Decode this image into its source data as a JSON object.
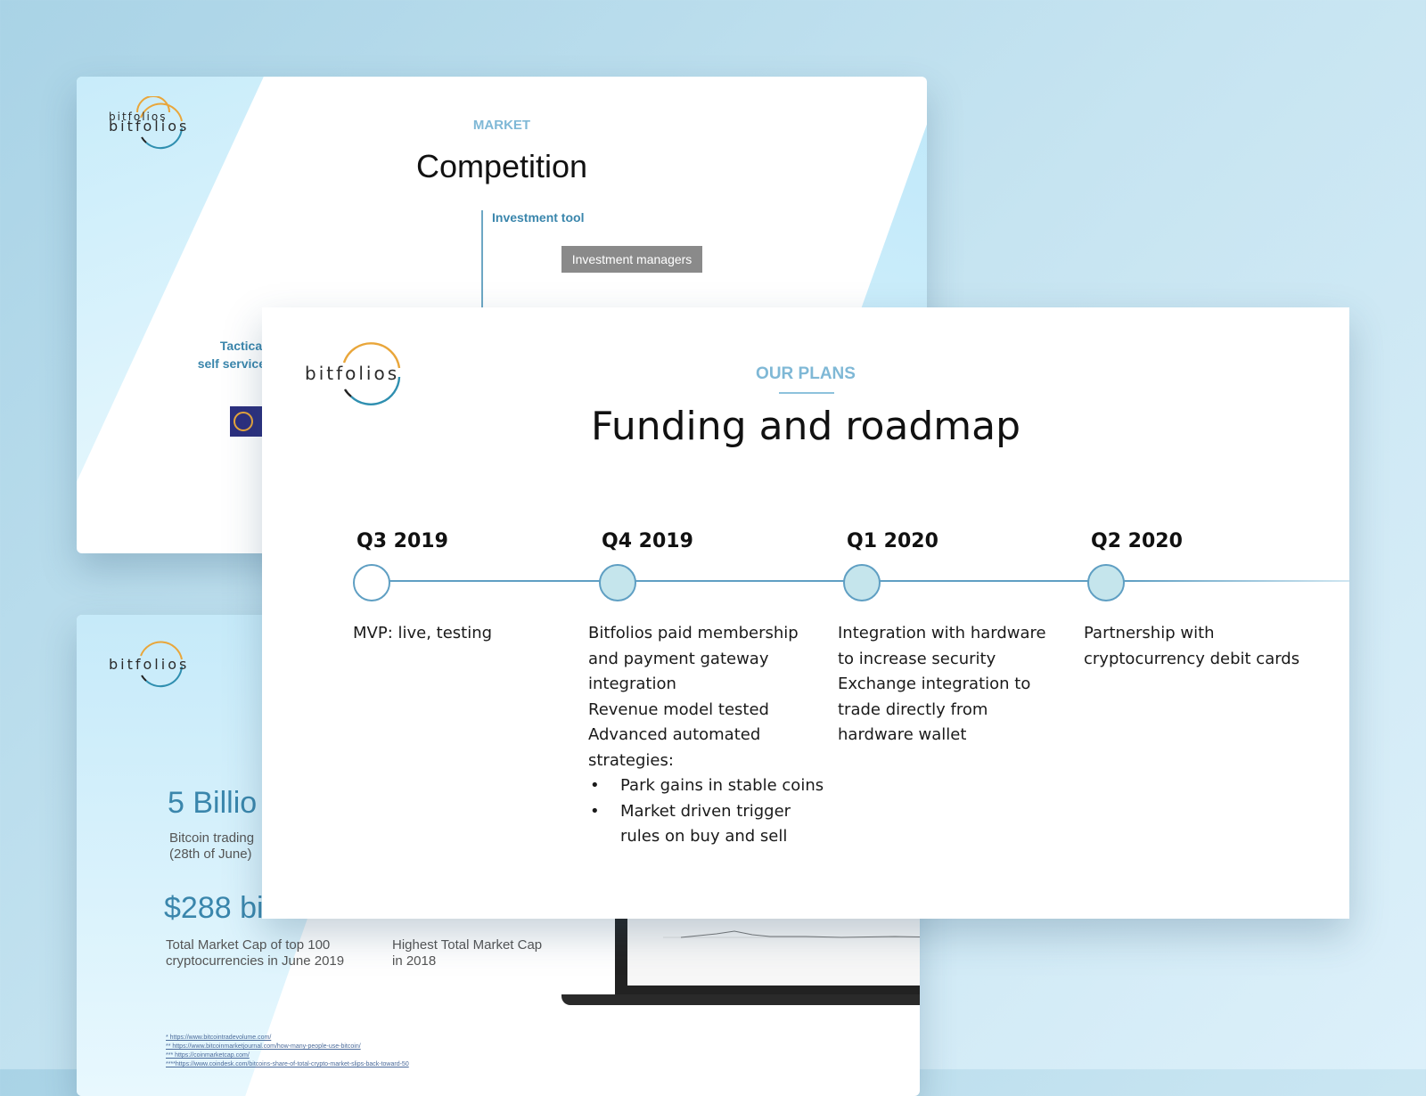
{
  "brand": {
    "logo_text": "bitfolios"
  },
  "competition_slide": {
    "kicker": "MARKET",
    "title": "Competition",
    "axis_label": "Investment tool",
    "box_label": "Investment managers",
    "tactical_line1": "Tactical",
    "tactical_line2": "self service"
  },
  "market_slide": {
    "stat1_value": "5 Billio",
    "stat1_label_line1": "Bitcoin trading",
    "stat1_label_line2": "(28th of June)",
    "stat2_value": "$288 bi",
    "stat2_label": "Total Market Cap of top 100 cryptocurrencies in June 2019",
    "stat3_value": "",
    "stat3_label": "Highest Total Market Cap in 2018",
    "footnotes": [
      "* https://www.bitcointradevolume.com/",
      "** https://www.bitcoinmarketjournal.com/how-many-people-use-bitcoin/",
      "*** https://coinmarketcap.com/",
      "****https://www.coindesk.com/bitcoins-share-of-total-crypto-market-slips-back-toward-50"
    ]
  },
  "roadmap_slide": {
    "kicker": "OUR PLANS",
    "title": "Funding and roadmap",
    "phases": [
      {
        "label": "Q3 2019",
        "dot": "open",
        "lines": [
          "MVP: live, testing"
        ],
        "bullets": []
      },
      {
        "label": "Q4 2019",
        "dot": "filled",
        "lines": [
          "Bitfolios paid membership",
          "and payment gateway",
          "integration",
          "Revenue model tested",
          "Advanced automated",
          "strategies:"
        ],
        "bullets": [
          "Park gains in stable coins",
          "Market driven trigger rules on buy and sell"
        ]
      },
      {
        "label": "Q1 2020",
        "dot": "filled",
        "lines": [
          "Integration with hardware",
          "to increase security",
          "Exchange integration to",
          "trade directly from",
          "hardware wallet"
        ],
        "bullets": []
      },
      {
        "label": "Q2 2020",
        "dot": "filled",
        "lines": [
          "Partnership with",
          "cryptocurrency debit cards"
        ],
        "bullets": []
      }
    ]
  },
  "colors": {
    "accent_blue": "#3a86ac",
    "kicker_blue": "#7fb8d6",
    "timeline": "#5f9fc3",
    "logo_orange": "#e9a63a",
    "logo_teal": "#2f8fb0"
  }
}
